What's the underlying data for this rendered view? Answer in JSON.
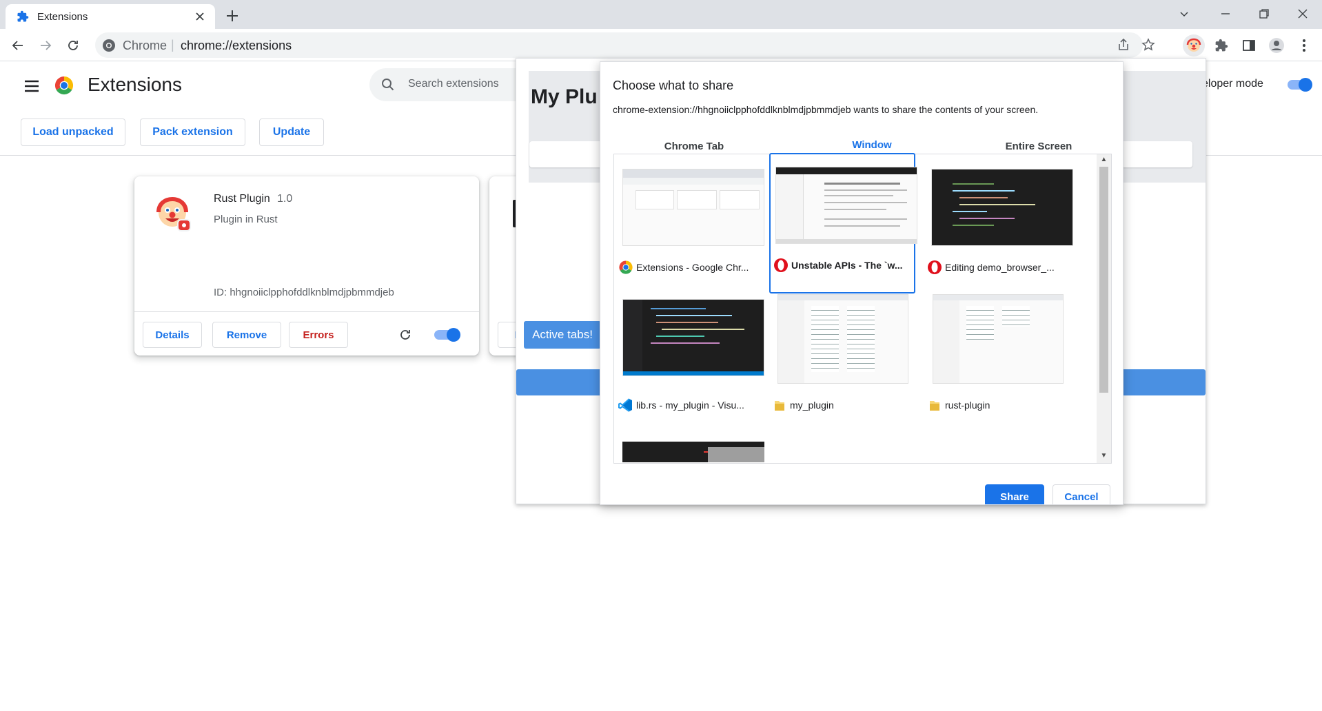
{
  "browser": {
    "tab": {
      "title": "Extensions",
      "icon": "puzzle-icon"
    },
    "omnibox": {
      "site_label": "Chrome",
      "separator": "|",
      "url": "chrome://extensions"
    }
  },
  "extensions_page": {
    "title": "Extensions",
    "search": {
      "placeholder": "Search extensions"
    },
    "developer_mode_label": "eloper mode",
    "developer_mode_on": true,
    "actions": {
      "load_unpacked": "Load unpacked",
      "pack_extension": "Pack extension",
      "update": "Update"
    },
    "cards": [
      {
        "name": "Rust Plugin",
        "version": "1.0",
        "description": "Plugin in Rust",
        "id_text": "ID: hhgnoiiclpphofddlknblmdjpbmmdjeb",
        "details_label": "Details",
        "remove_label": "Remove",
        "errors_label": "Errors",
        "enabled": true
      }
    ],
    "second_card_partial": {
      "details_label": "D"
    }
  },
  "extension_popup": {
    "title_partial": "My Plu",
    "active_tabs_button": "Active tabs!"
  },
  "share_dialog": {
    "title": "Choose what to share",
    "subtitle": "chrome-extension://hhgnoiiclpphofddlknblmdjpbmmdjeb wants to share the contents of your screen.",
    "tabs": [
      "Chrome Tab",
      "Window",
      "Entire Screen"
    ],
    "active_tab": "Window",
    "windows": [
      {
        "label": "Extensions - Google Chr...",
        "app_icon": "chrome-icon",
        "theme": "light",
        "selected": false
      },
      {
        "label": "Unstable APIs - The `w...",
        "app_icon": "opera-icon",
        "theme": "light",
        "selected": true
      },
      {
        "label": "Editing demo_browser_...",
        "app_icon": "opera-icon",
        "theme": "dark",
        "selected": false
      },
      {
        "label": "lib.rs - my_plugin - Visu...",
        "app_icon": "vscode-icon",
        "theme": "dark",
        "selected": false
      },
      {
        "label": "my_plugin",
        "app_icon": "folder-icon",
        "theme": "light",
        "selected": false
      },
      {
        "label": "rust-plugin",
        "app_icon": "folder-icon",
        "theme": "light",
        "selected": false
      }
    ],
    "share_button": "Share",
    "cancel_button": "Cancel"
  },
  "colors": {
    "accent": "#1a73e8",
    "tabstrip": "#dee1e6",
    "popup_blue": "#4a90e2",
    "danger": "#c5221f"
  }
}
